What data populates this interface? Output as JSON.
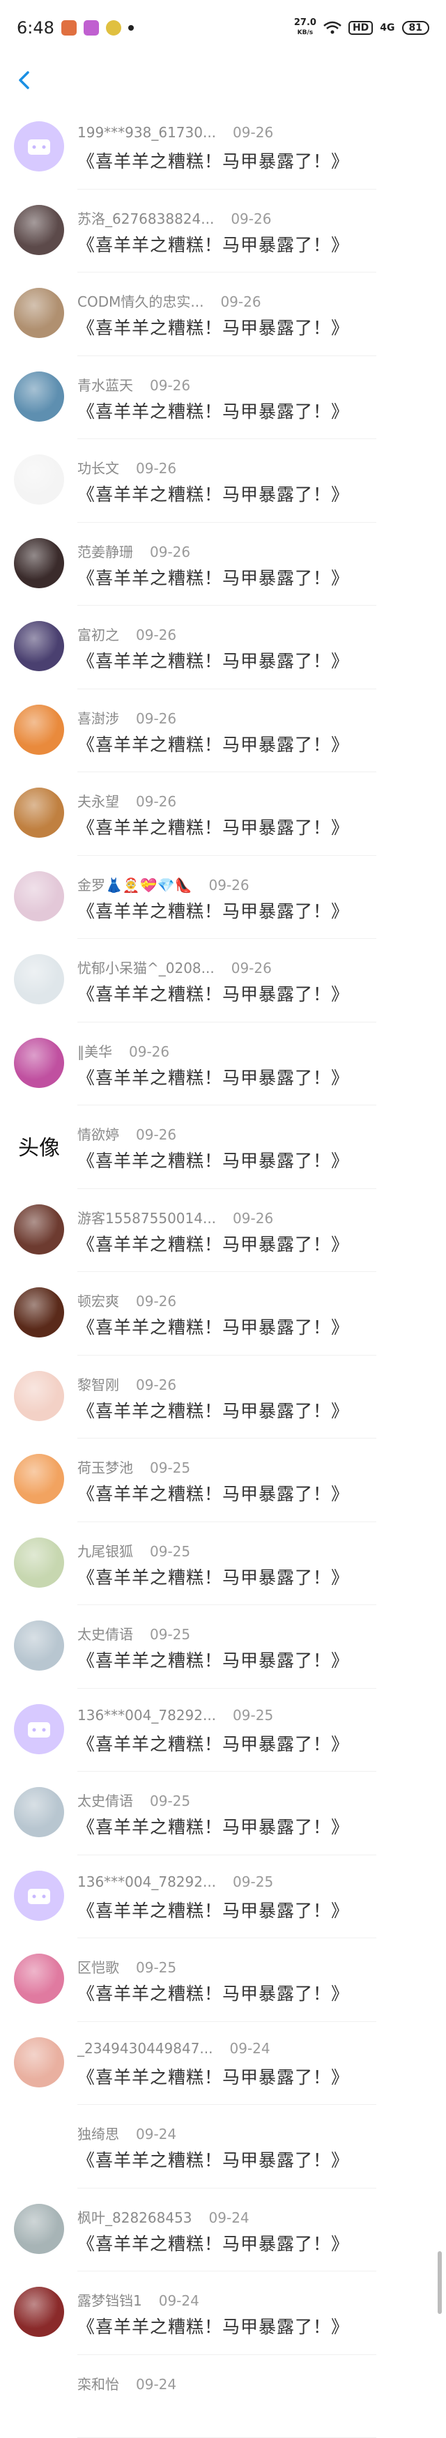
{
  "status": {
    "time": "6:48",
    "speed_value": "27.0",
    "speed_unit": "KB/s",
    "hd": "HD",
    "signal": "4G",
    "battery": "81"
  },
  "colors": {
    "accent": "#1a8fe3"
  },
  "comments": [
    {
      "name": "199***938_61730...",
      "date": "09-26",
      "msg": "《喜羊羊之糟糕！马甲暴露了！》",
      "avatar": "default",
      "color": "#d7c9ff"
    },
    {
      "name": "苏洛_6276838824...",
      "date": "09-26",
      "msg": "《喜羊羊之糟糕！马甲暴露了！》",
      "avatar": "photo",
      "color": "#5c4a4a"
    },
    {
      "name": "CODM情久的忠实...",
      "date": "09-26",
      "msg": "《喜羊羊之糟糕！马甲暴露了！》",
      "avatar": "photo",
      "color": "#b09070"
    },
    {
      "name": "青水蓝天",
      "date": "09-26",
      "msg": "《喜羊羊之糟糕！马甲暴露了！》",
      "avatar": "photo",
      "color": "#5e8fb0"
    },
    {
      "name": "功长文",
      "date": "09-26",
      "msg": "《喜羊羊之糟糕！马甲暴露了！》",
      "avatar": "photo",
      "color": "#f4f4f4"
    },
    {
      "name": "范姜静珊",
      "date": "09-26",
      "msg": "《喜羊羊之糟糕！马甲暴露了！》",
      "avatar": "photo",
      "color": "#3a2b2b"
    },
    {
      "name": "富初之",
      "date": "09-26",
      "msg": "《喜羊羊之糟糕！马甲暴露了！》",
      "avatar": "photo",
      "color": "#4a4070"
    },
    {
      "name": "喜澍涉",
      "date": "09-26",
      "msg": "《喜羊羊之糟糕！马甲暴露了！》",
      "avatar": "photo",
      "color": "#e98a3c"
    },
    {
      "name": "夫永望",
      "date": "09-26",
      "msg": "《喜羊羊之糟糕！马甲暴露了！》",
      "avatar": "photo",
      "color": "#c08040"
    },
    {
      "name": "金罗👗🤶💝💎👠",
      "date": "09-26",
      "msg": "《喜羊羊之糟糕！马甲暴露了！》",
      "avatar": "photo",
      "color": "#e3c8d8"
    },
    {
      "name": "忧郁小呆猫^_0208...",
      "date": "09-26",
      "msg": "《喜羊羊之糟糕！马甲暴露了！》",
      "avatar": "photo",
      "color": "#dfe6ea"
    },
    {
      "name": "‖美华",
      "date": "09-26",
      "msg": "《喜羊羊之糟糕！马甲暴露了！》",
      "avatar": "photo",
      "color": "#c050a0"
    },
    {
      "name": "情欲婷",
      "date": "09-26",
      "msg": "《喜羊羊之糟糕！马甲暴露了！》",
      "avatar": "text",
      "avatar_text": "头像",
      "color": "#ffffff"
    },
    {
      "name": "游客15587550014...",
      "date": "09-26",
      "msg": "《喜羊羊之糟糕！马甲暴露了！》",
      "avatar": "photo",
      "color": "#6d3b30"
    },
    {
      "name": "顿宏爽",
      "date": "09-26",
      "msg": "《喜羊羊之糟糕！马甲暴露了！》",
      "avatar": "photo",
      "color": "#5a2a1a"
    },
    {
      "name": "黎智刚",
      "date": "09-26",
      "msg": "《喜羊羊之糟糕！马甲暴露了！》",
      "avatar": "photo",
      "color": "#f3d1c6"
    },
    {
      "name": "荷玉梦池",
      "date": "09-25",
      "msg": "《喜羊羊之糟糕！马甲暴露了！》",
      "avatar": "photo",
      "color": "#f2a360"
    },
    {
      "name": "九尾银狐",
      "date": "09-25",
      "msg": "《喜羊羊之糟糕！马甲暴露了！》",
      "avatar": "photo",
      "color": "#c7d7b0"
    },
    {
      "name": "太史倩语",
      "date": "09-25",
      "msg": "《喜羊羊之糟糕！马甲暴露了！》",
      "avatar": "photo",
      "color": "#b8c6d0"
    },
    {
      "name": "136***004_78292...",
      "date": "09-25",
      "msg": "《喜羊羊之糟糕！马甲暴露了！》",
      "avatar": "default",
      "color": "#d7c9ff"
    },
    {
      "name": "太史倩语",
      "date": "09-25",
      "msg": "《喜羊羊之糟糕！马甲暴露了！》",
      "avatar": "photo",
      "color": "#b8c6d0"
    },
    {
      "name": "136***004_78292...",
      "date": "09-25",
      "msg": "《喜羊羊之糟糕！马甲暴露了！》",
      "avatar": "default",
      "color": "#d7c9ff"
    },
    {
      "name": "区恺歌",
      "date": "09-25",
      "msg": "《喜羊羊之糟糕！马甲暴露了！》",
      "avatar": "photo",
      "color": "#e07aa0"
    },
    {
      "name": "_2349430449847...",
      "date": "09-24",
      "msg": "《喜羊羊之糟糕！马甲暴露了！》",
      "avatar": "photo",
      "color": "#e9b0a0"
    },
    {
      "name": "独绮思",
      "date": "09-24",
      "msg": "《喜羊羊之糟糕！马甲暴露了！》",
      "avatar": "none",
      "color": "#ffffff"
    },
    {
      "name": "枫叶_828268453",
      "date": "09-24",
      "msg": "《喜羊羊之糟糕！马甲暴露了！》",
      "avatar": "photo",
      "color": "#a7b4b6"
    },
    {
      "name": "露梦铛铛1",
      "date": "09-24",
      "msg": "《喜羊羊之糟糕！马甲暴露了！》",
      "avatar": "photo",
      "color": "#8a2a2a"
    },
    {
      "name": "栾和怡",
      "date": "09-24",
      "msg": "",
      "avatar": "none",
      "color": "#ffffff"
    }
  ]
}
